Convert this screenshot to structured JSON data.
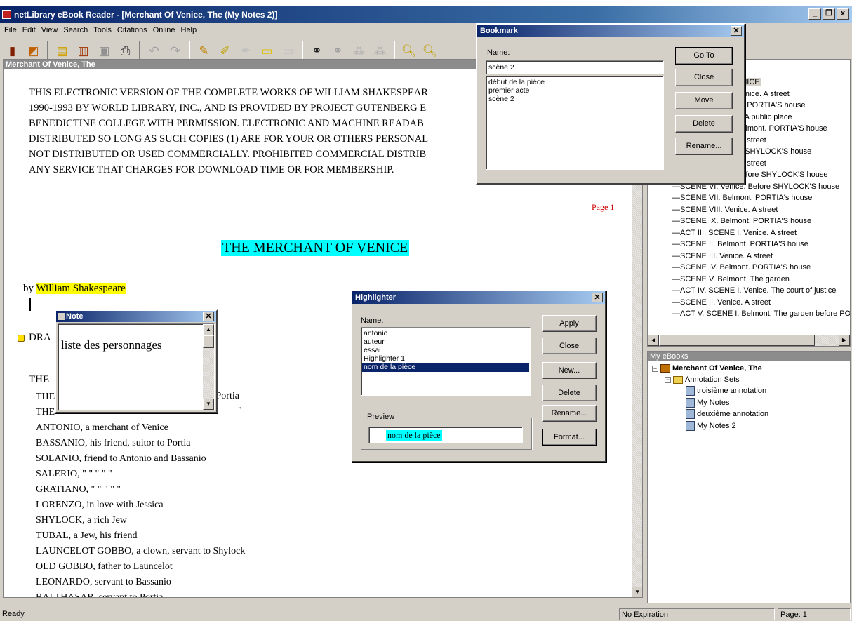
{
  "window": {
    "title": "netLibrary eBook Reader - [Merchant Of Venice, The (My Notes 2)]",
    "controls": [
      "_",
      "ř",
      "x"
    ]
  },
  "menu": [
    "File",
    "Edit",
    "View",
    "Search",
    "Tools",
    "Citations",
    "Online",
    "Help"
  ],
  "toolbar_icons": [
    "open-book-icon",
    "library-icon",
    "notes-icon",
    "bookmark-icon",
    "save-icon",
    "print-icon",
    "back-icon",
    "forward-icon",
    "annotate-icon",
    "highlighter-icon",
    "pen-icon",
    "note-icon",
    "note-alt-icon",
    "find-icon",
    "find-next-icon",
    "find-prev-icon",
    "find-all-icon",
    "zoom-in-icon",
    "zoom-out-icon"
  ],
  "doc": {
    "pane_title": "Merchant Of Venice, The",
    "legal_lines": [
      "THIS ELECTRONIC VERSION OF THE COMPLETE WORKS OF WILLIAM SHAKESPEAR",
      "1990-1993 BY WORLD LIBRARY, INC., AND IS PROVIDED BY PROJECT GUTENBERG E",
      "BENEDICTINE COLLEGE WITH PERMISSION.  ELECTRONIC AND MACHINE READAB",
      "DISTRIBUTED SO LONG AS SUCH COPIES (1) ARE FOR YOUR OR OTHERS PERSONAL",
      "NOT DISTRIBUTED OR USED COMMERCIALLY.  PROHIBITED COMMERCIAL DISTRIB",
      "ANY SERVICE THAT CHARGES FOR DOWNLOAD TIME OR FOR MEMBERSHIP."
    ],
    "page_label": "Page 1",
    "play_title": "THE MERCHANT OF VENICE",
    "by_prefix": "by ",
    "author": "William Shakespeare",
    "dra_text": "DRA",
    "the_text": "THE",
    "portia_fragment": "o Portia",
    "quote_fragment": "\"",
    "cast_partial": [
      "THE",
      "THE"
    ],
    "cast": [
      "ANTONIO, a merchant of Venice",
      "BASSANIO, his friend, suitor to Portia",
      "SOLANIO,   friend to Antonio and Bassanio",
      "SALERIO,     \"   \"   \"   \"   \"",
      "GRATIANO,     \"   \"   \"   \"   \"",
      "LORENZO, in love with Jessica",
      "SHYLOCK, a rich Jew",
      "TUBAL, a Jew, his friend",
      "LAUNCELOT GOBBO, a clown, servant to Shylock",
      "OLD GOBBO, father to Launcelot",
      "LEONARDO, servant to Bassanio",
      "BALTHASAR, servant to Portia"
    ]
  },
  "toc": {
    "items": [
      "ENICE",
      "Venice. A street",
      "nt. PORTIA'S house",
      "e. A public place",
      "Belmont. PORTIA'S house",
      ". A street",
      "e. SHYLOCK'S house",
      ". A street",
      "Before SHYLOCK'S house",
      "SCENE VI.  Venice. Before SHYLOCK'S house",
      "SCENE VII.  Belmont. PORTIA's house",
      "SCENE VIII.  Venice. A street",
      "SCENE IX.  Belmont. PORTIA'S house",
      "ACT III. SCENE I.  Venice. A street",
      "SCENE II.  Belmont. PORTIA'S house",
      "SCENE III.  Venice. A street",
      "SCENE IV.  Belmont. PORTIA'S house",
      "SCENE V.  Belmont. The garden",
      "ACT IV. SCENE I.  Venice. The court of justice",
      "SCENE II.  Venice. A street",
      "ACT V. SCENE I.  Belmont. The garden before PO"
    ]
  },
  "ebooks": {
    "title": "My eBooks",
    "book": "Merchant Of Venice, The",
    "folder": "Annotation Sets",
    "sets": [
      "troisième annotation",
      "My Notes",
      "deuxième annotation",
      "My Notes 2"
    ]
  },
  "status": {
    "left": "Ready",
    "expiration": "No Expiration",
    "page": "Page: 1"
  },
  "bookmark_dialog": {
    "title": "Bookmark",
    "name_label": "Name:",
    "name_value": "scène 2",
    "items": [
      "début de la pièce",
      "premier acte",
      "scène 2"
    ],
    "buttons": {
      "goto": "Go To",
      "close": "Close",
      "move": "Move",
      "delete": "Delete",
      "rename": "Rename..."
    }
  },
  "highlighter_dialog": {
    "title": "Highlighter",
    "name_label": "Name:",
    "items": [
      "antonio",
      "auteur",
      "essai",
      "Highlighter 1",
      "nom de la pièce"
    ],
    "selected_index": 4,
    "preview_label": "Preview",
    "preview_text": "nom de la pièce",
    "buttons": {
      "apply": "Apply",
      "close": "Close",
      "new": "New...",
      "delete": "Delete",
      "rename": "Rename...",
      "format": "Format..."
    }
  },
  "note_dialog": {
    "title": "Note",
    "text": "liste des personnages"
  },
  "colors": {
    "title_active": "#0a246a",
    "highlight_cyan": "#00ffff",
    "highlight_yellow": "#ffff00",
    "page_label_red": "#d00000"
  }
}
